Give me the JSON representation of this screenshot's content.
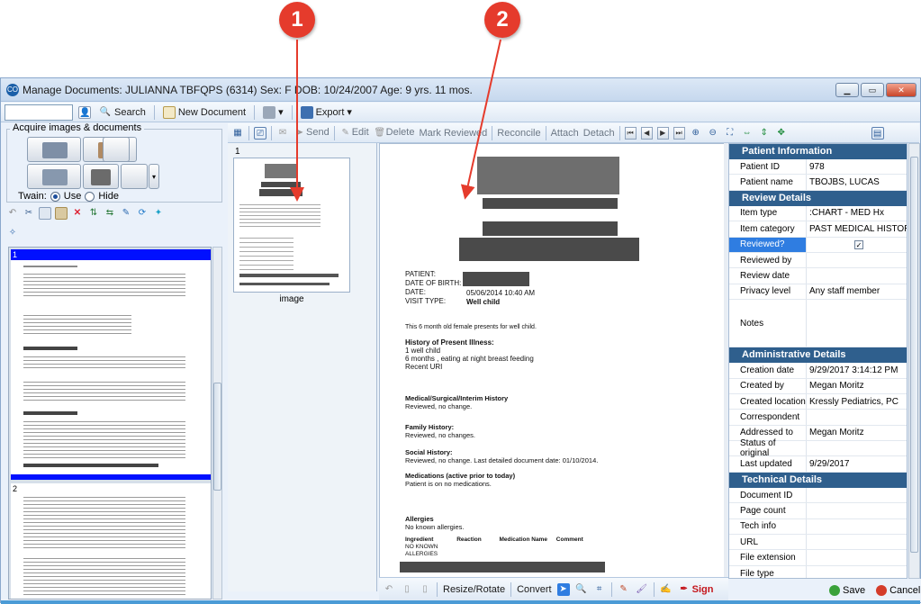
{
  "callouts": [
    "1",
    "2"
  ],
  "window": {
    "title": "Manage Documents: JULIANNA TBFQPS (6314)  Sex: F  DOB: 10/24/2007  Age: 9 yrs. 11 mos.",
    "app_icon": "CO"
  },
  "toolbar": {
    "search": "Search",
    "new_document": "New Document",
    "export": "Export"
  },
  "left": {
    "acquire_label": "Acquire images & documents",
    "twain_label": "Twain:",
    "use": "Use",
    "hide": "Hide",
    "pages": [
      "1",
      "2"
    ]
  },
  "mid_toolbar": {
    "send": "Send",
    "edit": "Edit",
    "delete": "Delete",
    "mark_reviewed": "Mark Reviewed",
    "reconcile": "Reconcile",
    "attach": "Attach",
    "detach": "Detach"
  },
  "mid_thumb": {
    "number": "1",
    "caption": "image"
  },
  "document": {
    "patient_label": "PATIENT:",
    "dob_label": "DATE OF BIRTH:",
    "date_label": "DATE:",
    "date_value": "05/06/2014 10:40 AM",
    "visit_label": "VISIT TYPE:",
    "visit_value": "Well child",
    "intro": "This 6 month old female presents for well child.",
    "hpi_title": "History of Present Illness:",
    "hpi_1": "1  well child",
    "hpi_2": "6 months , eating at night breast feeding",
    "hpi_3": "Recent URI",
    "msh_title": "Medical/Surgical/Interim History",
    "msh_text": "Reviewed, no change.",
    "fh_title": "Family History:",
    "fh_text": "Reviewed, no changes.",
    "sh_title": "Social History:",
    "sh_text": "Reviewed, no change. Last detailed document date: 01/10/2014.",
    "med_title": "Medications (active prior to today)",
    "med_text": "Patient is on no medications.",
    "allergies_title": "Allergies",
    "allergies_text": "No known allergies.",
    "col_ingredient": "Ingredient",
    "col_reaction": "Reaction",
    "col_med_name": "Medication Name",
    "col_comment": "Comment",
    "nka_1": "NO KNOWN",
    "nka_2": "ALLERGIES"
  },
  "bottom_toolbar": {
    "resize": "Resize/Rotate",
    "convert": "Convert",
    "sign": "Sign"
  },
  "details": {
    "patient_info": "Patient Information",
    "patient_id_label": "Patient ID",
    "patient_id": "978",
    "patient_name_label": "Patient name",
    "patient_name": "TBOJBS, LUCAS",
    "review_details": "Review Details",
    "item_type_label": "Item type",
    "item_type": ":CHART - MED Hx",
    "item_category_label": "Item category",
    "item_category": "PAST MEDICAL HISTORY",
    "reviewed_label": "Reviewed?",
    "reviewed_by_label": "Reviewed by",
    "review_date_label": "Review date",
    "privacy_label": "Privacy level",
    "privacy": "Any staff member",
    "notes_label": "Notes",
    "admin_details": "Administrative Details",
    "creation_date_label": "Creation date",
    "creation_date": "9/29/2017 3:14:12 PM",
    "created_by_label": "Created by",
    "created_by": "Megan Moritz",
    "created_location_label": "Created location",
    "created_location": "Kressly Pediatrics, PC",
    "correspondent_label": "Correspondent",
    "addressed_to_label": "Addressed to",
    "addressed_to": "Megan Moritz",
    "status_label": "Status of original",
    "last_updated_label": "Last updated",
    "last_updated": "9/29/2017",
    "tech_details": "Technical Details",
    "doc_id_label": "Document ID",
    "page_count_label": "Page count",
    "tech_info_label": "Tech info",
    "url_label": "URL",
    "file_ext_label": "File extension",
    "file_type_label": "File type"
  },
  "footer": {
    "save": "Save",
    "cancel": "Cancel"
  },
  "colors": {
    "callout": "#e53b2c",
    "section_header": "#2f5f8d",
    "selected_row": "#2f7de1"
  }
}
